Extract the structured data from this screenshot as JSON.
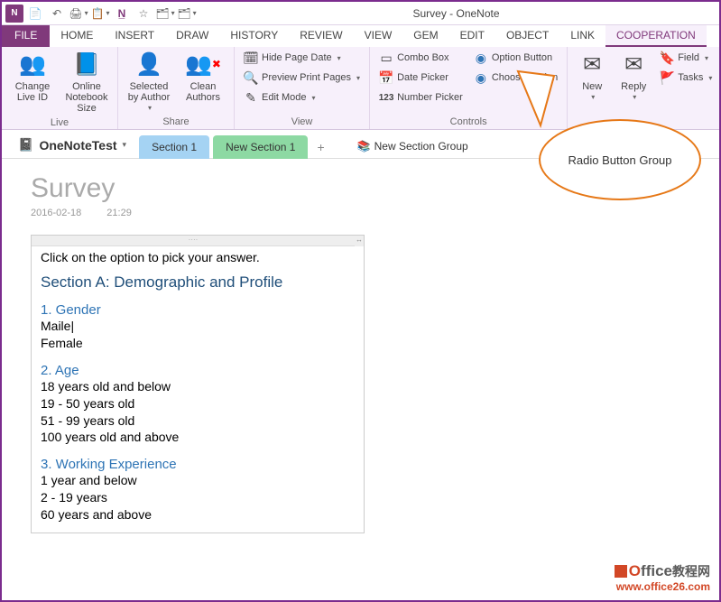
{
  "window": {
    "title": "Survey - OneNote"
  },
  "qat": {
    "undo": "↶",
    "docprops": "📄",
    "print": "🖨",
    "touch": "☝",
    "n_icon": "N̲",
    "favorite": "☆",
    "dropdownA": "📋",
    "dropdownB": "🗂"
  },
  "ribbon_tabs": {
    "file": "FILE",
    "home": "HOME",
    "insert": "INSERT",
    "draw": "DRAW",
    "history": "HISTORY",
    "review": "REVIEW",
    "view": "VIEW",
    "gem": "GEM",
    "edit": "EDIT",
    "object": "OBJECT",
    "link": "LINK",
    "cooperation": "COOPERATION"
  },
  "ribbon": {
    "live": {
      "label": "Live",
      "change_live_id": "Change Live ID",
      "notebook_size": "Online Notebook Size"
    },
    "share": {
      "label": "Share",
      "selected_by_author": "Selected by Author",
      "clean_authors": "Clean Authors"
    },
    "viewgrp": {
      "label": "View",
      "hide_page_date": "Hide Page Date",
      "preview_print": "Preview Print Pages",
      "edit_mode": "Edit Mode"
    },
    "controls": {
      "label": "Controls",
      "combo": "Combo Box",
      "date_picker": "Date Picker",
      "number_picker": "Number Picker",
      "option_button": "Option Button",
      "choose_option": "Choose Option"
    },
    "mailgrp": {
      "new": "New",
      "reply": "Reply",
      "field": "Field",
      "tasks": "Tasks"
    }
  },
  "notebook": {
    "name": "OneNoteTest",
    "tabs": {
      "section1": "Section 1",
      "new_section1": "New Section 1"
    },
    "add_tab": "+",
    "section_group": "New Section Group"
  },
  "page": {
    "title": "Survey",
    "date": "2016-02-18",
    "time": "21:29",
    "intro": "Click on the option to pick your answer.",
    "section_a": "Section A: Demographic and Profile",
    "q1": {
      "head": "1. Gender",
      "opts": [
        "Maile",
        "Female"
      ]
    },
    "q2": {
      "head": "2. Age",
      "opts": [
        "18 years old and below",
        "19 - 50 years old",
        "51 - 99 years old",
        "100 years old and above"
      ]
    },
    "q3": {
      "head": "3. Working Experience",
      "opts": [
        "1 year and below",
        "2 - 19 years",
        "60 years and above"
      ]
    }
  },
  "callout": {
    "text": "Radio Button Group"
  },
  "watermark": {
    "brand_o": "O",
    "brand_rest": "ffice",
    "brand_cn": "教程网",
    "url": "www.office26.com"
  }
}
